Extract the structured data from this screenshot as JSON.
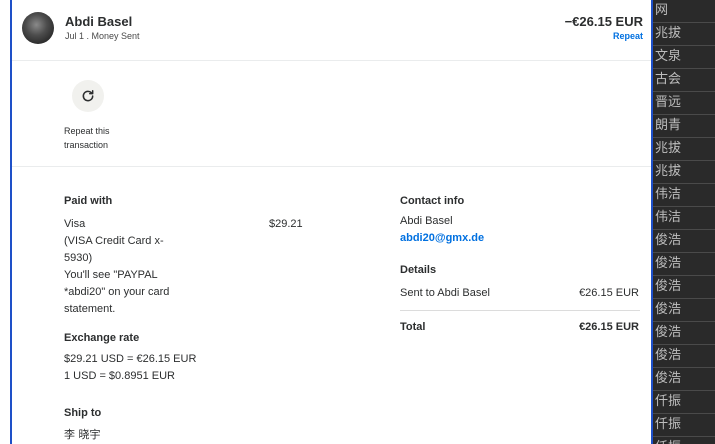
{
  "header": {
    "name": "Abdi Basel",
    "subtitle": "Jul 1 . Money Sent",
    "amount": "−€26.15 EUR",
    "repeat_link": "Repeat"
  },
  "actions": {
    "repeat_icon": "refresh-icon",
    "repeat_label": "Repeat this transaction"
  },
  "paid_with": {
    "heading": "Paid with",
    "lines": [
      "Visa",
      "(VISA Credit Card x-",
      "5930)",
      "You'll see \"PAYPAL",
      "*abdi20\" on your card",
      "statement."
    ],
    "amount": "$29.21"
  },
  "exchange_rate": {
    "heading": "Exchange rate",
    "line1": "$29.21 USD = €26.15 EUR",
    "line2": "1 USD = $0.8951 EUR"
  },
  "ship_to": {
    "heading": "Ship to",
    "name": "李 晓宇"
  },
  "contact": {
    "heading": "Contact info",
    "name": "Abdi Basel",
    "email": "abdi20@gmx.de"
  },
  "details": {
    "heading": "Details",
    "row_label": "Sent to Abdi Basel",
    "row_value": "€26.15 EUR",
    "total_label": "Total",
    "total_value": "€26.15 EUR"
  },
  "background_strips": [
    "⽹",
    "兆拔",
    "文泉",
    "古会",
    "晋远",
    "朗青",
    "兆拔",
    "兆拔",
    "伟洁",
    "伟洁",
    "俊浩",
    "俊浩",
    "俊浩",
    "俊浩",
    "俊浩",
    "俊浩",
    "俊浩",
    "仟振",
    "仟振",
    "仟振"
  ],
  "colors": {
    "accent": "#0070e0",
    "frame": "#1e50c8"
  }
}
